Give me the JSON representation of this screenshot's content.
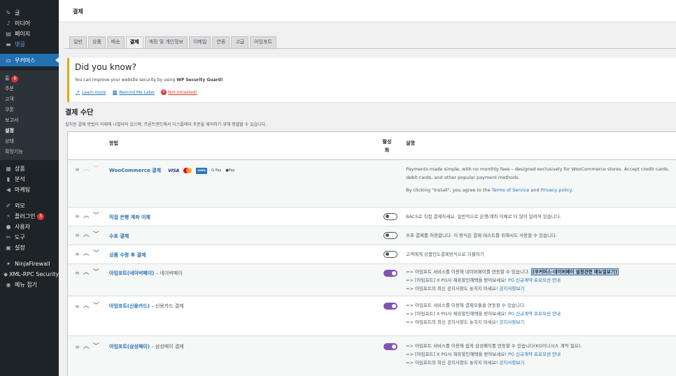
{
  "sidebar": {
    "top_items": [
      {
        "label": "글",
        "icon": "pin-icon"
      },
      {
        "label": "미디어",
        "icon": "media-icon"
      },
      {
        "label": "페이지",
        "icon": "page-icon"
      },
      {
        "label": "댓글",
        "icon": "comment-icon"
      }
    ],
    "current": {
      "label": "우커머스",
      "icon": "woo-icon"
    },
    "submenu": [
      {
        "label": "홈",
        "badge": "6"
      },
      {
        "label": "주문"
      },
      {
        "label": "고객"
      },
      {
        "label": "쿠폰"
      },
      {
        "label": "보고서"
      },
      {
        "label": "설정"
      },
      {
        "label": "상태"
      },
      {
        "label": "확장기능"
      }
    ],
    "items_after": [
      {
        "label": "상품",
        "icon": "product-icon"
      },
      {
        "label": "분석",
        "icon": "analytics-icon"
      },
      {
        "label": "마케팅",
        "icon": "marketing-icon"
      }
    ],
    "items_after2": [
      {
        "label": "외모",
        "icon": "brush-icon"
      },
      {
        "label": "플러그인",
        "icon": "plugin-icon",
        "badge": "5"
      },
      {
        "label": "사용자",
        "icon": "user-icon"
      },
      {
        "label": "도구",
        "icon": "wrench-icon"
      },
      {
        "label": "설정",
        "icon": "settings-icon"
      }
    ],
    "items_after3": [
      {
        "label": "NinjaFirewall",
        "icon": "ninja-icon"
      },
      {
        "label": "XML-RPC Security",
        "icon": "shield-icon"
      },
      {
        "label": "메뉴 접기",
        "icon": "collapse-icon"
      }
    ]
  },
  "header": {
    "title": "결제"
  },
  "tabs": [
    "일반",
    "상품",
    "배송",
    "결제",
    "계정 및 개인정보",
    "이메일",
    "연동",
    "고급",
    "아임포트"
  ],
  "active_tab": "결제",
  "notice": {
    "title": "Did you know?",
    "text_prefix": "You can improve your website security by using ",
    "text_bold": "WP Security Guard!",
    "links": [
      {
        "label": "Learn more"
      },
      {
        "label": "Remind Me Later"
      },
      {
        "label": "Not Intrested!"
      }
    ]
  },
  "section": {
    "title": "결제 수단",
    "description": "설치된 결제 방법이 아래에 나열되어 있으며, 프론트엔드에서 디스플레이 주문을 제어하기 위해 정렬할 수 있습니다."
  },
  "table": {
    "headers": {
      "method": "방법",
      "enabled_line1": "활성",
      "enabled_line2": "화",
      "description": "설명"
    },
    "woocommerce": {
      "name": "WooCommerce 결제",
      "cards": [
        "VISA",
        "AMEX",
        "G Pay",
        "Pay"
      ],
      "desc1": "Payments made simple, with no monthly fees – designed exclusively for WooCommerce stores. Accept credit cards, debit cards, and other popular payment methods.",
      "desc2_prefix": "By clicking \"Install\", you agree to the ",
      "desc2_tos": "Terms of Service",
      "desc2_and": " and ",
      "desc2_privacy": "Privacy policy",
      "desc2_end": "."
    },
    "rows": [
      {
        "name": "직접 은행 계좌 이체",
        "sub": "",
        "enabled": false,
        "desc": "BACS로 직접 결제하세요. 일반적으로 은행/계좌 이체로 더 많이 알려져 있습니다."
      },
      {
        "name": "수표 결제",
        "sub": "",
        "enabled": false,
        "desc": "수표 결제를 허용합니다. 이 방식은 결제 테스트를 위해서도 사용할 수 있습니다."
      },
      {
        "name": "상품 수령 후 결제",
        "sub": "",
        "enabled": false,
        "desc": "고객에게 상품인도결제방식으로 지불하기"
      }
    ],
    "iamport_rows": [
      {
        "name": "아임포트(네이버페이)",
        "sub": " – 네이버페이",
        "enabled": true,
        "line1": "=> 아임포트 서비스를 이용해 네이버페이를 연동할 수 있습니다. ",
        "line1_link": "[우커머스-네이버페이 설정관련 매뉴얼보기]",
        "line2": "=> [아임포트] X PG사 제휴할인혜택을 받아보세요! ",
        "line2_link": "PG 신규계약 프로모션 안내",
        "line3": "=> 아임포트의 최신 공지사항도 놓치지 마세요! ",
        "line3_link": "공지사항보기"
      },
      {
        "name": "아임포트(신용카드)",
        "sub": " – 신용카드 결제",
        "enabled": true,
        "line1": "=> 아임포트 서비스를 이용해 결제모듈을 연동할 수 있습니다.",
        "line1_link": "",
        "line2": "=> [아임포트] X PG사 제휴할인혜택을 받아보세요! ",
        "line2_link": "PG 신규계약 프로모션 안내",
        "line3": "=> 아임포트의 최신 공지사항도 놓치지 마세요! ",
        "line3_link": "공지사항보기"
      },
      {
        "name": "아임포트(삼성페이)",
        "sub": " – 삼성페이 결제",
        "enabled": true,
        "line1": "=> 아임포트 서비스를 이용해 쉽게 삼성페이를 연동할 수 있습니다(KG이니시스 계약 필요).",
        "line1_link": "",
        "line2": "=> [아임포트] X PG사 제휴할인혜택을 받아보세요! ",
        "line2_link": "PG 신규계약 프로모션 안내",
        "line3": "=> 아임포트의 최신 공지사항도 놓치지 마세요! ",
        "line3_link": "공지사항보기"
      }
    ]
  }
}
